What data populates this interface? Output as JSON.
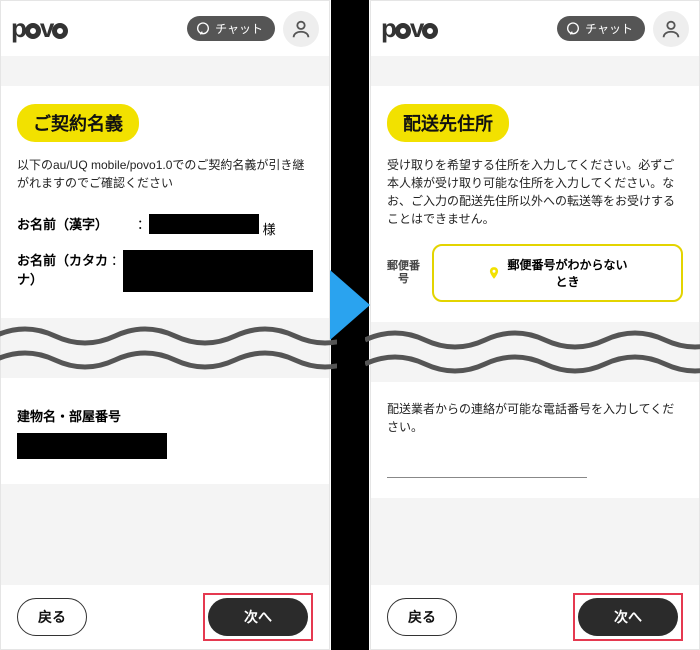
{
  "header": {
    "logo_text": "povo",
    "chat_label": "チャット"
  },
  "left": {
    "section_title": "ご契約名義",
    "intro": "以下のau/UQ mobile/povo1.0でのご契約名義が引き継がれますのでご確認ください",
    "name_kanji_label": "お名前（漢字）",
    "name_kanji_suffix": "様",
    "name_kana_label": "お名前（カタカナ）",
    "building_label": "建物名・部屋番号"
  },
  "right": {
    "section_title": "配送先住所",
    "intro": "受け取りを希望する住所を入力してください。必ずご本人様が受け取り可能な住所を入力してください。なお、ご入力の配送先住所以外への転送等をお受けすることはできません。",
    "zip_label": "郵便番\n号",
    "zip_button": "郵便番号がわからない\nとき",
    "phone_note": "配送業者からの連絡が可能な電話番号を入力してください。"
  },
  "footer": {
    "back": "戻る",
    "next": "次へ"
  }
}
